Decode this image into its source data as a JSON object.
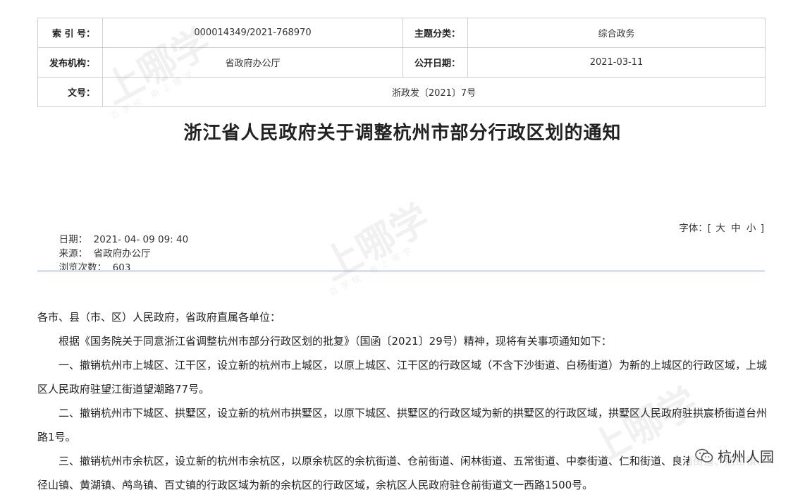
{
  "meta": {
    "index_label": "索 引 号：",
    "index_value": "000014349/2021-768970",
    "topic_label": "主题分类：",
    "topic_value": "综合政务",
    "issuer_label": "发布机构：",
    "issuer_value": "省政府办公厅",
    "pubdate_label": "公开日期：",
    "pubdate_value": "2021-03-11",
    "docno_label": "文号：",
    "docno_value": "浙政发〔2021〕7号"
  },
  "title": "浙江省人民政府关于调整杭州市部分行政区划的通知",
  "info": {
    "date": "日期：  2021- 04- 09 09: 40",
    "source": "来源：  省政府办公厅",
    "views": "浏览次数：  603"
  },
  "font_size": {
    "label": "字体：",
    "open": "[",
    "large": "大",
    "medium": "中",
    "small": "小",
    "close": "]"
  },
  "body": {
    "p1": "各市、县（市、区）人民政府，省政府直属各单位：",
    "p2": "根据《国务院关于同意浙江省调整杭州市部分行政区划的批复》（国函〔2021〕29号）精神，现将有关事项通知如下：",
    "p3": "一、撤销杭州市上城区、江干区，设立新的杭州市上城区，以原上城区、江干区的行政区域（不含下沙街道、白杨街道）为新的上城区的行政区域，上城区人民政府驻望江街道望潮路77号。",
    "p4": "二、撤销杭州市下城区、拱墅区，设立新的杭州市拱墅区，以原下城区、拱墅区的行政区域为新的拱墅区的行政区域，拱墅区人民政府驻拱宸桥街道台州路1号。",
    "p5": "三、撤销杭州市余杭区，设立新的杭州市余杭区，以原余杭区的余杭街道、仓前街道、闲林街道、五常街道、中泰街道、仁和街道、良渚街道、瓶窑镇、径山镇、黄湖镇、鸬鸟镇、百丈镇的行政区域为新的余杭区的行政区域，余杭区人民政府驻仓前街道文一西路1500号。"
  },
  "watermark": {
    "text": "上哪学",
    "sub": "百学校  用上哪学"
  },
  "badge": {
    "text": "杭州人园",
    "icon": "wechat-icon"
  }
}
